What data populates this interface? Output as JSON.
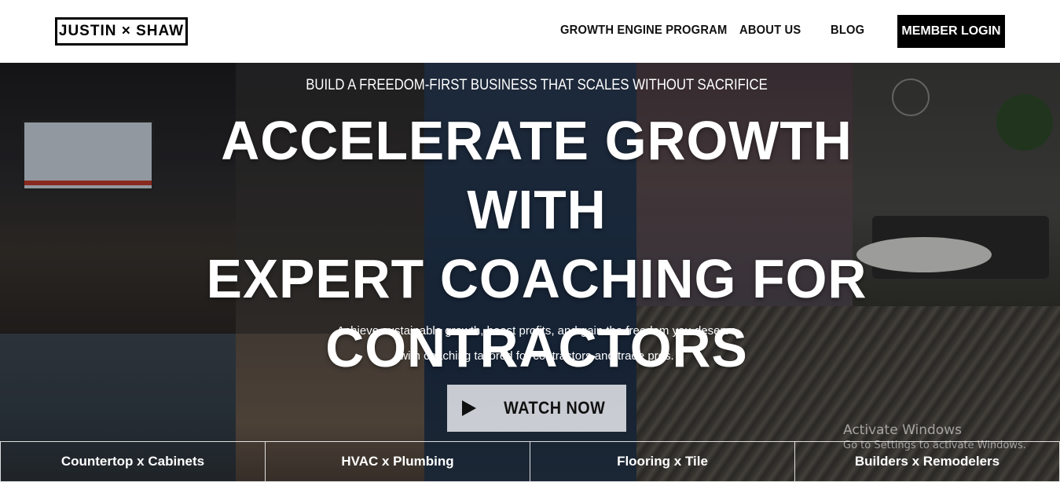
{
  "header": {
    "logo_text": "JUSTIN × SHAW",
    "nav": {
      "growth": "GROWTH ENGINE PROGRAM",
      "about": "ABOUT US",
      "blog": "BLOG",
      "login": "MEMBER LOGIN"
    }
  },
  "hero": {
    "eyebrow": "BUILD A FREEDOM-FIRST BUSINESS THAT SCALES WITHOUT SACRIFICE",
    "headline_line1": "ACCELERATE GROWTH WITH",
    "headline_line2": "EXPERT COACHING FOR",
    "headline_line3": "CONTRACTORS",
    "subtext_line1": "Achieve sustainable growth, boost profits, and gain the freedom you deserve",
    "subtext_line2": "with coaching tailored for contractors and trade pros.",
    "cta_label": "WATCH NOW",
    "cta_icon": "play-icon"
  },
  "tabs": [
    {
      "label": "Countertop x Cabinets"
    },
    {
      "label": "HVAC x Plumbing"
    },
    {
      "label": "Flooring x Tile"
    },
    {
      "label": "Builders x Remodelers"
    }
  ],
  "watermark": {
    "line1": "Activate Windows",
    "line2": "Go to Settings to activate Windows."
  },
  "colors": {
    "header_bg": "#ffffff",
    "login_bg": "#000000",
    "text_on_hero": "#ffffff"
  }
}
